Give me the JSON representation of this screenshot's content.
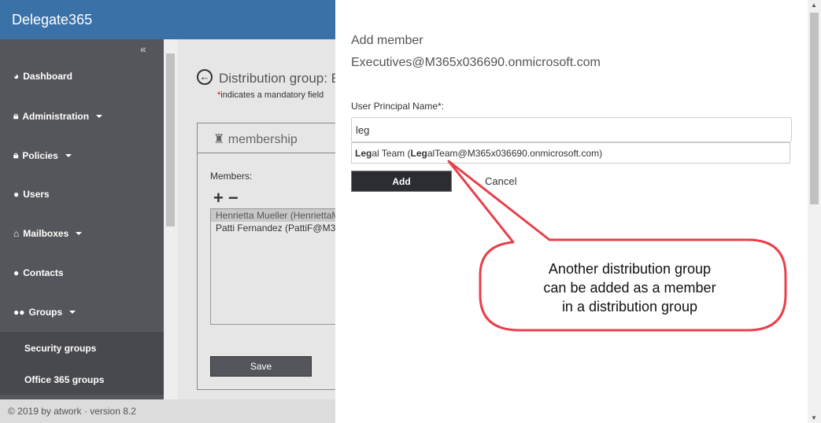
{
  "app": {
    "title": "Delegate365",
    "footer": "© 2019 by atwork · version 8.2"
  },
  "sidebar": {
    "collapse": "«",
    "items": [
      {
        "label": "Dashboard",
        "icon": "dashboard-icon"
      },
      {
        "label": "Administration",
        "icon": "lock-icon"
      },
      {
        "label": "Policies",
        "icon": "lock-icon"
      },
      {
        "label": "Users",
        "icon": "user-icon"
      },
      {
        "label": "Mailboxes",
        "icon": "home-icon"
      },
      {
        "label": "Contacts",
        "icon": "user-icon"
      },
      {
        "label": "Groups",
        "icon": "users-icon"
      }
    ],
    "subitems": [
      "Security groups",
      "Office 365 groups"
    ]
  },
  "page": {
    "title": "Distribution group: E",
    "mandatory_star": "*",
    "mandatory": "indicates a mandatory field",
    "panel_title": "membership",
    "members_label": "Members:",
    "plus": "+",
    "minus": "−",
    "members": [
      "Henrietta Mueller (HenriettaM",
      "Patti Fernandez (PattiF@M3"
    ],
    "save": "Save"
  },
  "modal": {
    "title": "Add member",
    "subtitle": "Executives@M365x036690.onmicrosoft.com",
    "upn_label": "User Principal Name*:",
    "upn_value": "leg",
    "suggestion": {
      "b1": "Leg",
      "t1": "al Team (",
      "b2": "Leg",
      "t2": "alTeam@M365x036690.onmicrosoft.com)"
    },
    "add": "Add",
    "cancel": "Cancel"
  },
  "callout": {
    "lines": [
      "Another distribution group",
      "can be added as a member",
      "in a distribution group"
    ],
    "color": "#e8404a"
  }
}
